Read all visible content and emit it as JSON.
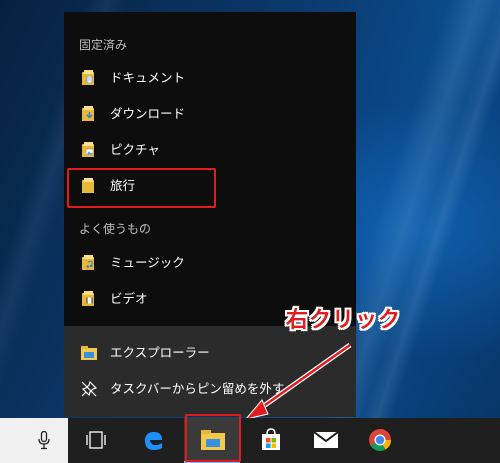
{
  "jumplist": {
    "pinned_header": "固定済み",
    "pinned": [
      {
        "label": "ドキュメント",
        "icon": "documents-folder-icon"
      },
      {
        "label": "ダウンロード",
        "icon": "downloads-folder-icon"
      },
      {
        "label": "ピクチャ",
        "icon": "pictures-folder-icon"
      },
      {
        "label": "旅行",
        "icon": "folder-icon"
      }
    ],
    "frequent_header": "よく使うもの",
    "frequent": [
      {
        "label": "ミュージック",
        "icon": "music-folder-icon"
      },
      {
        "label": "ビデオ",
        "icon": "videos-folder-icon"
      }
    ],
    "actions": [
      {
        "label": "エクスプローラー",
        "icon": "file-explorer-icon"
      },
      {
        "label": "タスクバーからピン留めを外す",
        "icon": "unpin-icon"
      }
    ]
  },
  "annotation": {
    "callout": "右クリック",
    "color": "#e21c1c"
  },
  "taskbar": {
    "items": [
      "microphone-icon",
      "task-view-icon",
      "edge-icon",
      "file-explorer-icon",
      "store-icon",
      "mail-icon",
      "chrome-icon"
    ],
    "active": "file-explorer-icon"
  }
}
